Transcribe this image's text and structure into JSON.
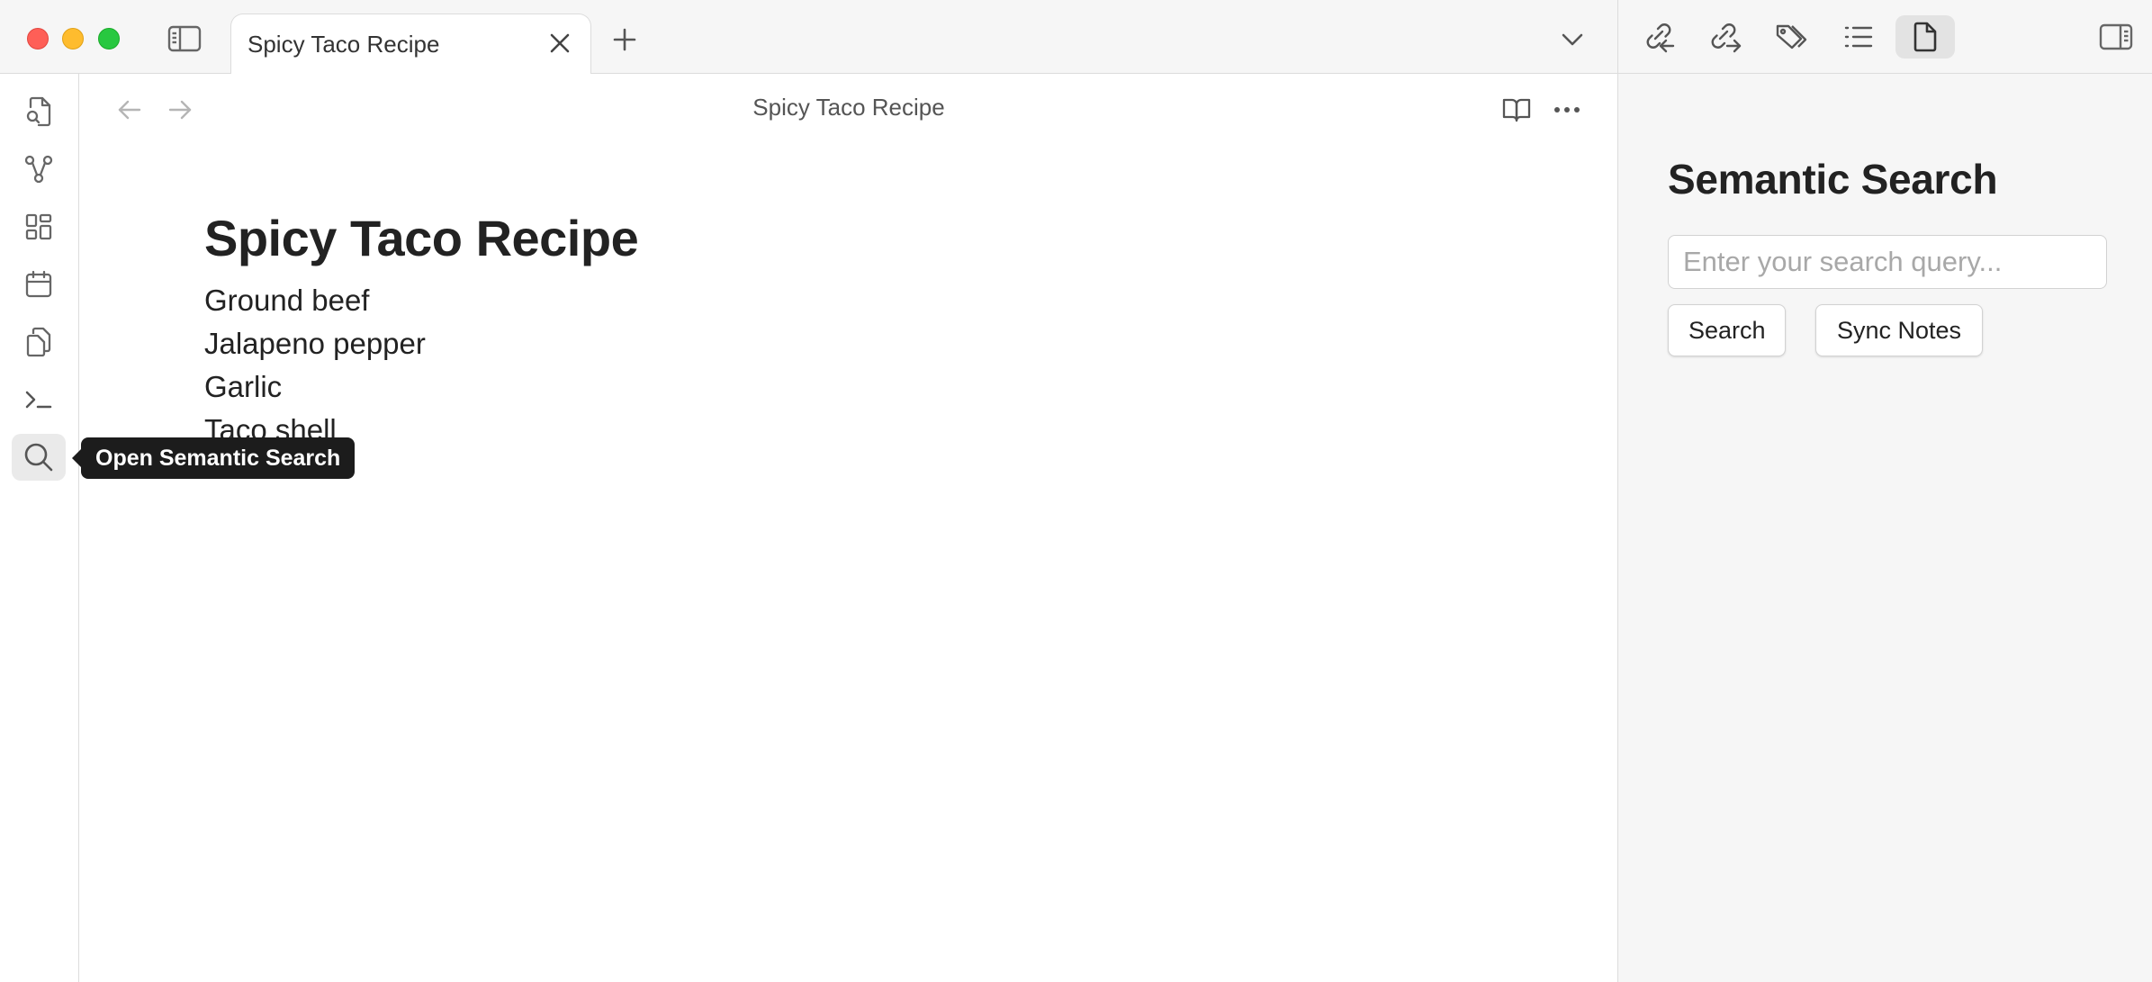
{
  "window": {
    "controls": {
      "close": "#fe5f57",
      "minimize": "#febc2e",
      "maximize": "#28c840"
    }
  },
  "tabs": [
    {
      "title": "Spicy Taco Recipe",
      "active": true
    }
  ],
  "toolbar_icons": {
    "left": [
      "sidebar-toggle-icon",
      "close-icon",
      "plus-icon",
      "chevron-down-icon"
    ],
    "right_panel": [
      "backlinks-icon",
      "outgoing-links-icon",
      "tags-icon",
      "outline-icon",
      "file-icon",
      "right-sidebar-toggle-icon"
    ],
    "active_right_panel": "file-icon"
  },
  "ribbon": {
    "items": [
      {
        "icon": "file-search-icon"
      },
      {
        "icon": "graph-icon"
      },
      {
        "icon": "canvas-icon"
      },
      {
        "icon": "calendar-icon"
      },
      {
        "icon": "copy-icon"
      },
      {
        "icon": "terminal-icon"
      },
      {
        "icon": "search-icon",
        "active": true
      }
    ],
    "tooltip": "Open Semantic Search"
  },
  "editor": {
    "view_title": "Spicy Taco Recipe",
    "note": {
      "title": "Spicy Taco Recipe",
      "lines": [
        "Ground beef",
        "Jalapeno pepper",
        "Garlic",
        "Taco shell"
      ]
    }
  },
  "semantic_search": {
    "heading": "Semantic Search",
    "input_value": "",
    "input_placeholder": "Enter your search query...",
    "search_label": "Search",
    "sync_label": "Sync Notes"
  },
  "colors": {
    "accent_tooltip_bg": "#1c1c1c",
    "panel_bg": "#f6f6f6",
    "border": "#dcdcdc"
  }
}
